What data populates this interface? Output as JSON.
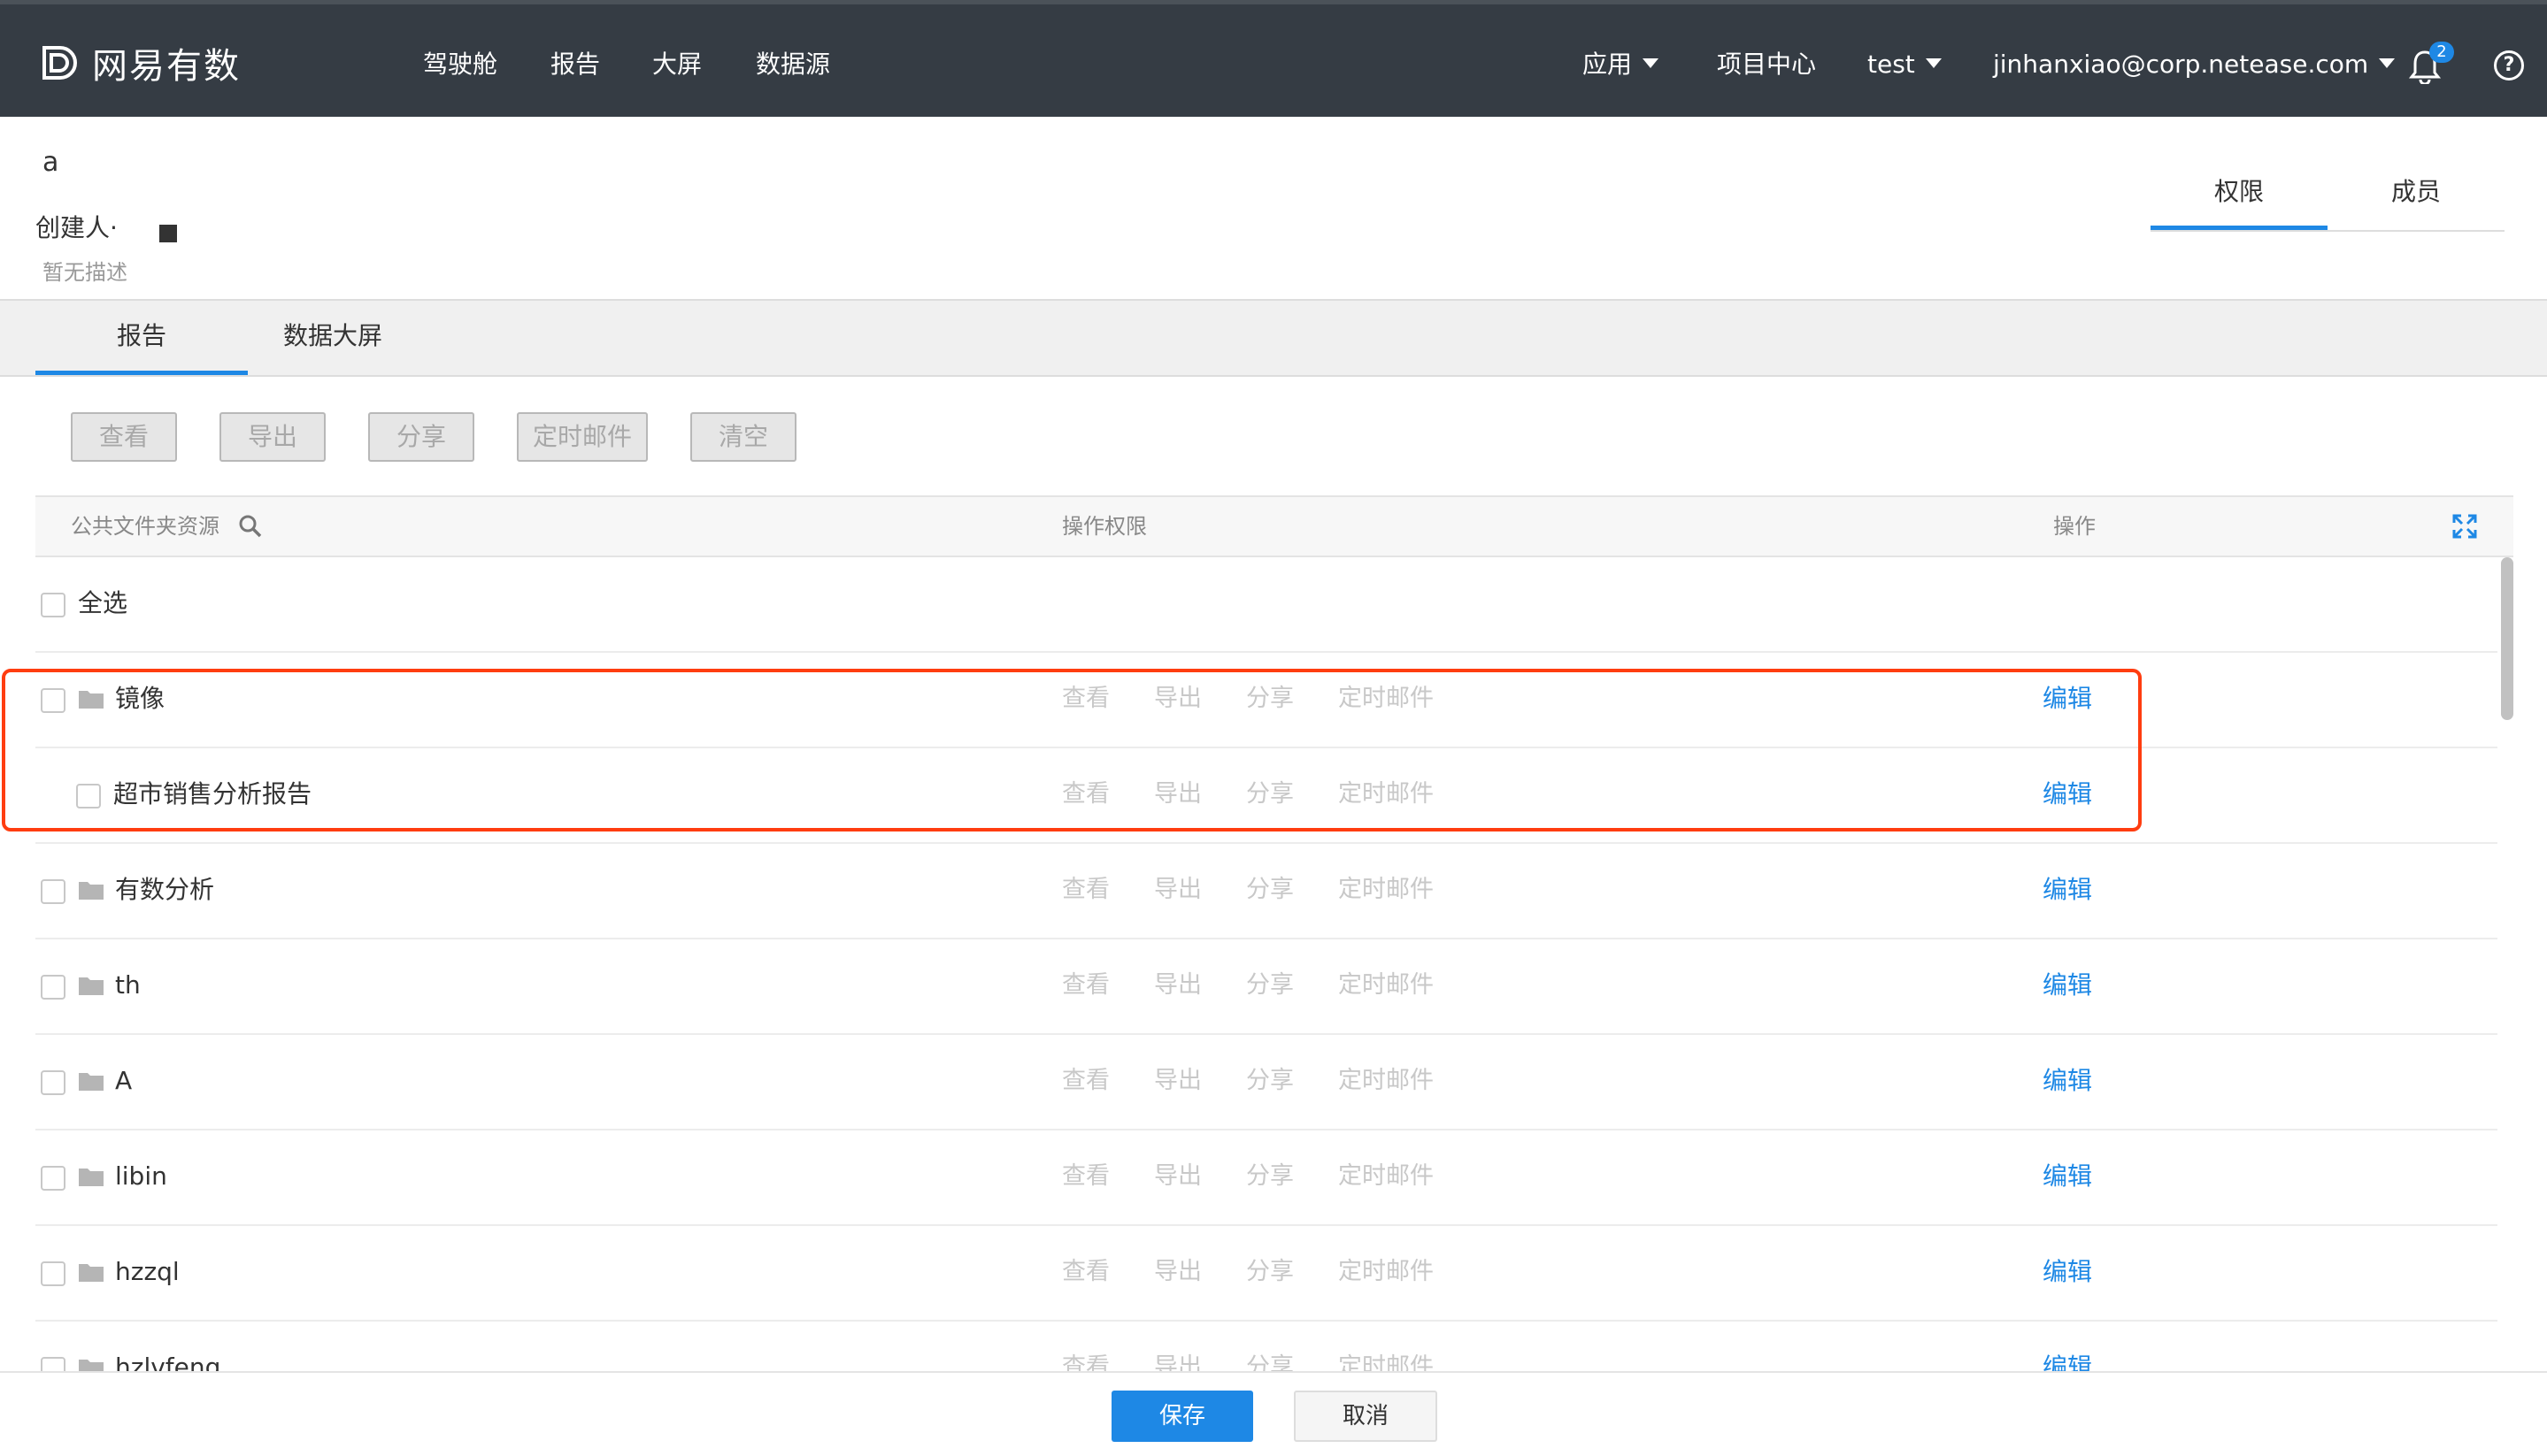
{
  "nav": {
    "logo_text": "网易有数",
    "links": [
      "驾驶舱",
      "报告",
      "大屏",
      "数据源"
    ],
    "app_menu": "应用",
    "project_center": "项目中心",
    "project": "test",
    "user": "jinhanxiao@corp.netease.com",
    "notification_count": "2",
    "help": "?"
  },
  "header": {
    "role_name": "a",
    "creator_label": "创建人·",
    "description": "暂无描述",
    "tabs": [
      "权限",
      "成员"
    ]
  },
  "subtabs": [
    "报告",
    "数据大屏"
  ],
  "actions": [
    "查看",
    "导出",
    "分享",
    "定时邮件",
    "清空"
  ],
  "table": {
    "columns": [
      "公共文件夹资源",
      "操作权限",
      "操作"
    ],
    "select_all": "全选",
    "permissions": [
      "查看",
      "导出",
      "分享",
      "定时邮件"
    ],
    "edit_label": "编辑",
    "rows": [
      {
        "name": "镜像",
        "type": "folder",
        "indent": 0
      },
      {
        "name": "超市销售分析报告",
        "type": "report",
        "indent": 1
      },
      {
        "name": "有数分析",
        "type": "folder",
        "indent": 0
      },
      {
        "name": "th",
        "type": "folder",
        "indent": 0
      },
      {
        "name": "A",
        "type": "folder",
        "indent": 0
      },
      {
        "name": "libin",
        "type": "folder",
        "indent": 0
      },
      {
        "name": "hzzql",
        "type": "folder",
        "indent": 0
      },
      {
        "name": "hzlvfeng",
        "type": "folder",
        "indent": 0
      }
    ]
  },
  "footer": {
    "save": "保存",
    "cancel": "取消"
  },
  "colors": {
    "nav_bg": "#353c44",
    "accent": "#1e88e5",
    "highlight": "#ff3d10"
  }
}
